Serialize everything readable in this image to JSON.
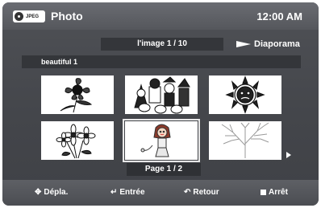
{
  "header": {
    "badge_text": "JPEG",
    "title": "Photo",
    "clock": "12:00 AM"
  },
  "toolbar": {
    "counter": "l'image 1 / 10",
    "slideshow_label": "Diaporama"
  },
  "file": {
    "name": "beautiful 1"
  },
  "thumbnails": [
    {
      "name": "flower-sketch-thumbnail",
      "selected": false
    },
    {
      "name": "halloween-figures-thumbnail",
      "selected": false
    },
    {
      "name": "sun-face-thumbnail",
      "selected": false
    },
    {
      "name": "daisies-thumbnail",
      "selected": false
    },
    {
      "name": "girl-cartoon-thumbnail",
      "selected": true
    },
    {
      "name": "bare-tree-thumbnail",
      "selected": false
    }
  ],
  "pagination": {
    "label": "Page 1 / 2"
  },
  "footer": {
    "move": "Dépla.",
    "enter": "Entrée",
    "back": "Retour",
    "stop": "Arrêt"
  }
}
